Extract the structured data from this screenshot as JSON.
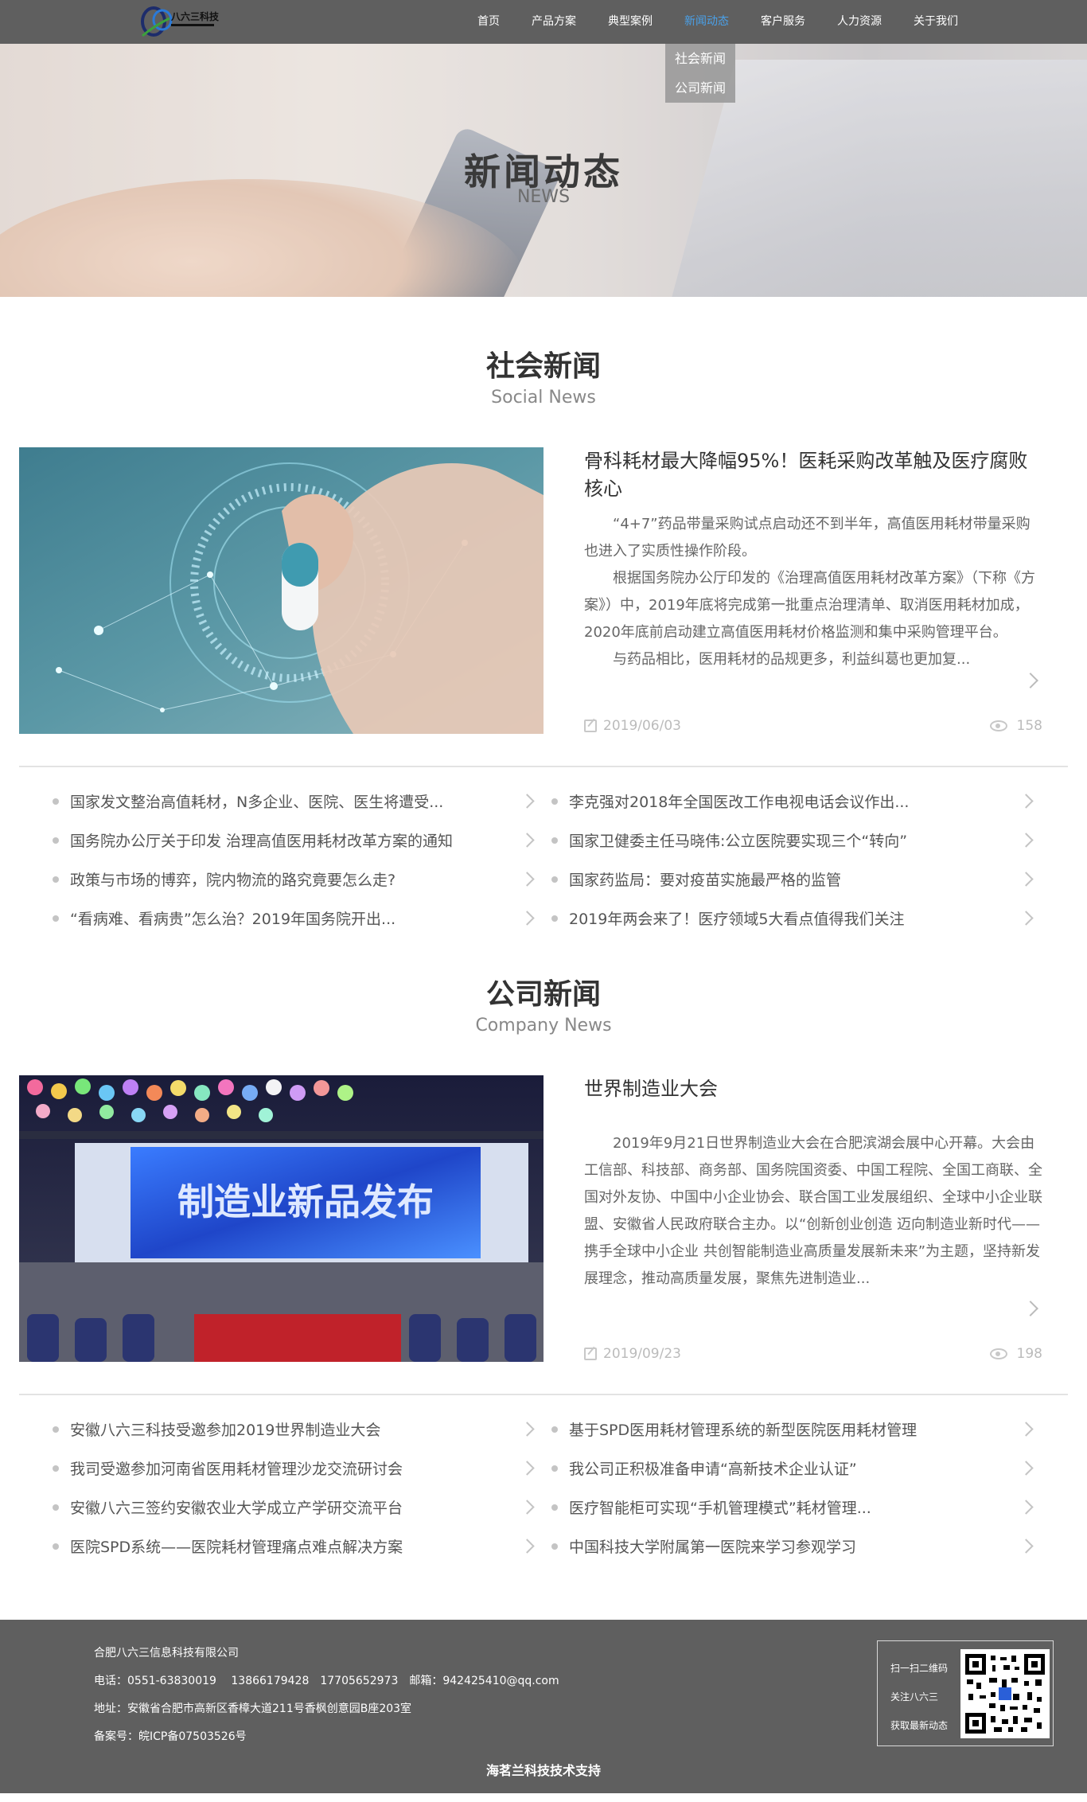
{
  "logo_text": "八六三科技",
  "nav": [
    "首页",
    "产品方案",
    "典型案例",
    "新闻动态",
    "客户服务",
    "人力资源",
    "关于我们"
  ],
  "nav_active": "新闻动态",
  "dropdown": [
    "社会新闻",
    "公司新闻"
  ],
  "banner": {
    "title": "新闻动态",
    "subtitle": "NEWS"
  },
  "social": {
    "title": "社会新闻",
    "subtitle": "Social News",
    "feature": {
      "headline": "骨科耗材最大降幅95%！医耗采购改革触及医疗腐败核心",
      "paragraphs": [
        "“4+7”药品带量采购试点启动还不到半年，高值医用耗材带量采购也进入了实质性操作阶段。",
        "根据国务院办公厅印发的《治理高值医用耗材改革方案》（下称《方案》）中，2019年底将完成第一批重点治理清单、取消医用耗材加成，2020年底前启动建立高值医用耗材价格监测和集中采购管理平台。",
        "与药品相比，医用耗材的品规更多，利益纠葛也更加复..."
      ],
      "date": "2019/06/03",
      "views": "158"
    },
    "list": [
      "国家发文整治高值耗材，N多企业、医院、医生将遭受...",
      "李克强对2018年全国医改工作电视电话会议作出...",
      "国务院办公厅关于印发 治理高值医用耗材改革方案的通知",
      "国家卫健委主任马晓伟:公立医院要实现三个“转向”",
      "政策与市场的博弈，院内物流的路究竟要怎么走?",
      "国家药监局：要对疫苗实施最严格的监管",
      "“看病难、看病贵”怎么治？2019年国务院开出...",
      "2019年两会来了！医疗领域5大看点值得我们关注"
    ]
  },
  "company": {
    "title": "公司新闻",
    "subtitle": "Company News",
    "feature": {
      "headline": "世界制造业大会",
      "paragraphs": [
        "2019年9月21日世界制造业大会在合肥滨湖会展中心开幕。大会由工信部、科技部、商务部、国务院国资委、中国工程院、全国工商联、全国对外友协、中国中小企业协会、联合国工业发展组织、全球中小企业联盟、安徽省人民政府联合主办。以“创新创业创造 迈向制造业新时代——携手全球中小企业 共创智能制造业高质量发展新未来”为主题，坚持新发展理念，推动高质量发展，聚焦先进制造业..."
      ],
      "image_caption": "制造业新品发布",
      "date": "2019/09/23",
      "views": "198"
    },
    "list": [
      "安徽八六三科技受邀参加2019世界制造业大会",
      "基于SPD医用耗材管理系统的新型医院医用耗材管理",
      "我司受邀参加河南省医用耗材管理沙龙交流研讨会",
      "我公司正积极准备申请“高新技术企业认证”",
      "安徽八六三签约安徽农业大学成立产学研交流平台",
      "医疗智能柜可实现“手机管理模式”耗材管理...",
      "医院SPD系统——医院耗材管理痛点难点解决方案",
      "中国科技大学附属第一医院来学习参观学习"
    ]
  },
  "footer": {
    "company": "合肥八六三信息科技有限公司",
    "phone": "电话：0551-63830019　 13866179428　17705652973　邮箱：942425410@qq.com",
    "address": "地址：安徽省合肥市高新区香樟大道211号香枫创意园B座203室",
    "icp": "备案号：皖ICP备07503526号",
    "qr_lines": [
      "扫一扫二维码",
      "关注八六三",
      "获取最新动态"
    ],
    "support": "海茗兰科技技术支持"
  },
  "colors": {
    "topbar": "#5f5f5f",
    "active": "#4aa0e8",
    "footer": "#5f5f5f"
  }
}
